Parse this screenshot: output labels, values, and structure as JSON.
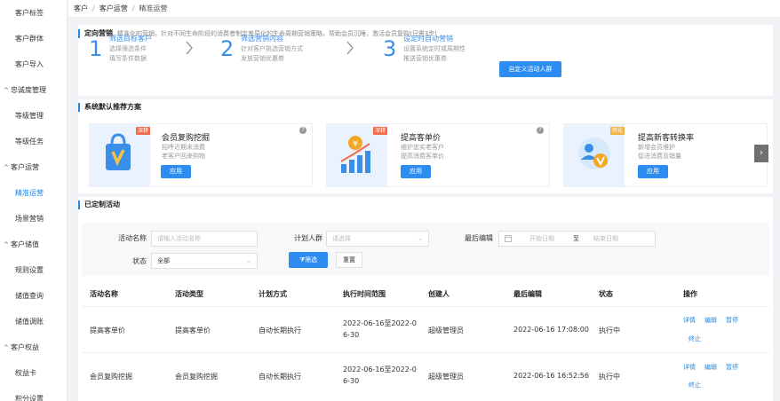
{
  "sidebar": {
    "items": [
      {
        "label": "客户标签",
        "type": "item"
      },
      {
        "label": "客户群体",
        "type": "item"
      },
      {
        "label": "客户导入",
        "type": "item"
      },
      {
        "label": "忠诚度管理",
        "type": "group"
      },
      {
        "label": "等级管理",
        "type": "item"
      },
      {
        "label": "等级任务",
        "type": "item"
      },
      {
        "label": "客户运营",
        "type": "group"
      },
      {
        "label": "精准运营",
        "type": "item",
        "active": true
      },
      {
        "label": "场景营销",
        "type": "item"
      },
      {
        "label": "客户储值",
        "type": "group"
      },
      {
        "label": "规则设置",
        "type": "item"
      },
      {
        "label": "储值查询",
        "type": "item"
      },
      {
        "label": "储值调账",
        "type": "item"
      },
      {
        "label": "客户权益",
        "type": "group"
      },
      {
        "label": "权益卡",
        "type": "item"
      },
      {
        "label": "积分设置",
        "type": "item"
      }
    ]
  },
  "breadcrumb": {
    "root": "客户",
    "mid": "客户运营",
    "current": "精准运营"
  },
  "directed": {
    "title": "定向营销",
    "desc": "精准化的营销，针对不同生命阶段的消费者制定差异化的生命周期营销策略，帮助会员沉睡，激活会员复购!只需3步!",
    "steps": [
      {
        "num": "1",
        "title": "筛选目标客户",
        "l1": "选择筛选条件",
        "l2": "填写条件数据"
      },
      {
        "num": "2",
        "title": "筛选营销内容",
        "l1": "针对客户挑选营销方式",
        "l2": "发放营销优惠券"
      },
      {
        "num": "3",
        "title": "设定时自动营销",
        "l1": "设置系统定时或周期性",
        "l2": "推送营销优惠券"
      }
    ],
    "custom_btn": "自定义活动人群"
  },
  "recommend": {
    "title": "系统默认推荐方案",
    "cards": [
      {
        "tag": "深耕",
        "title": "会员复购挖掘",
        "l1": "招呼近期未消费",
        "l2": "老客户回来购物",
        "btn": "应用"
      },
      {
        "tag": "深耕",
        "title": "提高客单价",
        "l1": "维护忠实老客户",
        "l2": "提高消费客单价",
        "btn": "应用"
      },
      {
        "tag": "转化",
        "title": "提高新客转换率",
        "l1": "新增会员维护",
        "l2": "促进消费及销量",
        "btn": "应用"
      }
    ],
    "help": "?",
    "next": "›"
  },
  "custom": {
    "title": "已定制活动",
    "filters": {
      "name_label": "活动名称",
      "name_placeholder": "请输入活动名称",
      "crowd_label": "计划人群",
      "crowd_placeholder": "请选择",
      "edit_label": "最后编辑",
      "start_placeholder": "开始日期",
      "to": "至",
      "end_placeholder": "结束日期",
      "status_label": "状态",
      "status_value": "全部",
      "filter_btn": "筛选",
      "reset_btn": "重置"
    },
    "columns": [
      "活动名称",
      "活动类型",
      "计划方式",
      "执行时间范围",
      "创建人",
      "最后编辑",
      "状态",
      "操作"
    ],
    "rows": [
      {
        "name": "提高客单价",
        "type": "提高客单价",
        "plan": "自动长期执行",
        "range_a": "2022-06-16至2022-0",
        "range_b": "6-30",
        "creator": "超级管理员",
        "edited": "2022-06-16 17:08:00",
        "status": "执行中",
        "ops": [
          "详情",
          "编辑",
          "暂停",
          "终止"
        ]
      },
      {
        "name": "会员复购挖掘",
        "type": "会员复购挖掘",
        "plan": "自动长期执行",
        "range_a": "2022-06-16至2022-0",
        "range_b": "6-30",
        "creator": "超级管理员",
        "edited": "2022-06-16 16:52:56",
        "status": "执行中",
        "ops": [
          "详情",
          "编辑",
          "暂停",
          "终止"
        ]
      }
    ]
  },
  "colors": {
    "accent": "#2d8cf0",
    "link": "#1e88e5"
  }
}
